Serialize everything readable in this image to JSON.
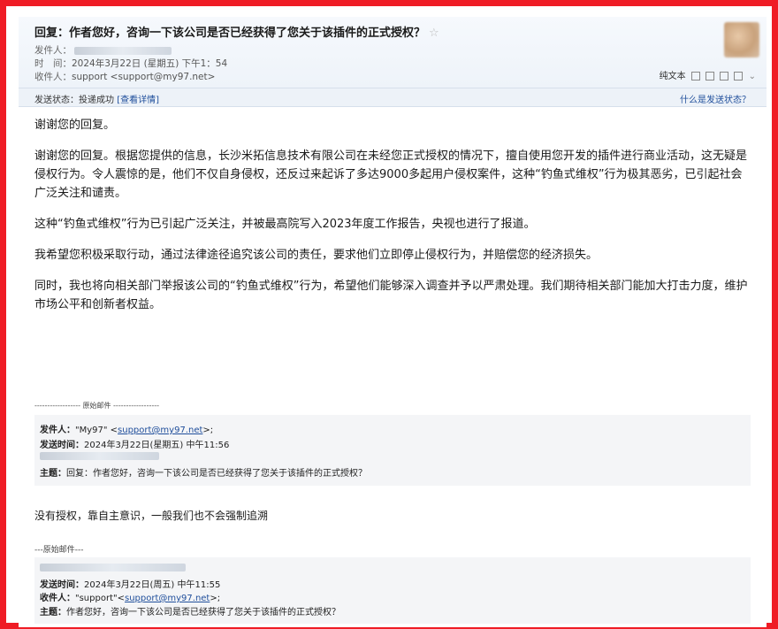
{
  "header": {
    "subject": "回复：作者您好，咨询一下该公司是否已经获得了您关于该插件的正式授权？",
    "sender_label": "发件人：",
    "time_label": "时　间：",
    "time_value": "2024年3月22日 (星期五) 下午1：54",
    "recipient_label": "收件人：",
    "recipient_value": "support <support@my97.net>",
    "plain_text": "纯文本",
    "status_label": "发送状态：",
    "status_value": "投递成功",
    "status_detail": "[查看详情]",
    "status_help": "什么是发送状态？"
  },
  "body": {
    "paragraphs": [
      "谢谢您的回复。",
      "谢谢您的回复。根据您提供的信息，长沙米拓信息技术有限公司在未经您正式授权的情况下，擅自使用您开发的插件进行商业活动，这无疑是侵权行为。令人震惊的是，他们不仅自身侵权，还反过来起诉了多达9000多起用户侵权案件，这种“钓鱼式维权”行为极其恶劣，已引起社会广泛关注和谴责。",
      "这种“钓鱼式维权”行为已引起广泛关注，并被最高院写入2023年度工作报告，央视也进行了报道。",
      "我希望您积极采取行动，通过法律途径追究该公司的责任，要求他们立即停止侵权行为，并赔偿您的经济损失。",
      "同时，我也将向相关部门举报该公司的“钓鱼式维权”行为，希望他们能够深入调查并予以严肃处理。我们期待相关部门能加大打击力度，维护市场公平和创新者权益。"
    ]
  },
  "quote1": {
    "divider": "------------------ 原始邮件 ------------------",
    "from_label": "发件人：",
    "from_value": "\"My97\" <",
    "from_email": "support@my97.net",
    "from_end": ">;",
    "time_label": "发送时间：",
    "time_value": "2024年3月22日(星期五) 中午11:56",
    "subject_label": "主题：",
    "subject_value": "回复：作者您好，咨询一下该公司是否已经获得了您关于该插件的正式授权？"
  },
  "reply2": "没有授权，靠自主意识，一般我们也不会强制追溯",
  "quote2": {
    "divider": "---原始邮件---",
    "time_label": "发送时间：",
    "time_value": "2024年3月22日(周五) 中午11:55",
    "to_label": "收件人：",
    "to_value": "\"support\"<",
    "to_email": "support@my97.net",
    "to_end": ">;",
    "subject_label": "主题：",
    "subject_value": "作者您好，咨询一下该公司是否已经获得了您关于该插件的正式授权？"
  },
  "colors": {
    "frame": "#ef1c25",
    "link": "#1f4e9b",
    "quote_bg": "#f4f5f7"
  }
}
